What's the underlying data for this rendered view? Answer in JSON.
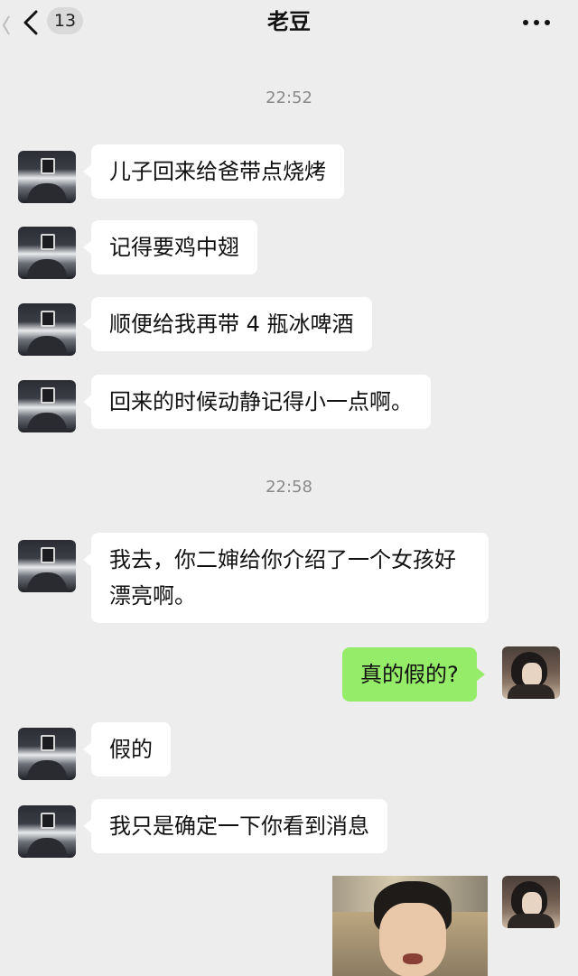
{
  "header": {
    "unread_count": "13",
    "title": "老豆",
    "back_icon": "chevron-left-icon",
    "more_icon": "more-dots-icon"
  },
  "messages": [
    {
      "type": "time",
      "text": "22:52"
    },
    {
      "type": "text",
      "sender": "dad",
      "text": "儿子回来给爸带点烧烤"
    },
    {
      "type": "text",
      "sender": "dad",
      "text": "记得要鸡中翅"
    },
    {
      "type": "text",
      "sender": "dad",
      "text": "顺便给我再带 4 瓶冰啤酒"
    },
    {
      "type": "text",
      "sender": "dad",
      "text": "回来的时候动静记得小一点啊。"
    },
    {
      "type": "time",
      "text": "22:58"
    },
    {
      "type": "text",
      "sender": "dad",
      "text": "我去，你二婶给你介绍了一个女孩好漂亮啊。"
    },
    {
      "type": "text",
      "sender": "me",
      "text": "真的假的?"
    },
    {
      "type": "text",
      "sender": "dad",
      "text": "假的"
    },
    {
      "type": "text",
      "sender": "dad",
      "text": "我只是确定一下你看到消息"
    },
    {
      "type": "sticker",
      "sender": "me",
      "description_icon": "crying-kid-sticker"
    }
  ],
  "colors": {
    "background": "#ededed",
    "incoming_bubble": "#ffffff",
    "outgoing_bubble": "#95ec69",
    "timestamp_text": "#8a8a8a"
  }
}
